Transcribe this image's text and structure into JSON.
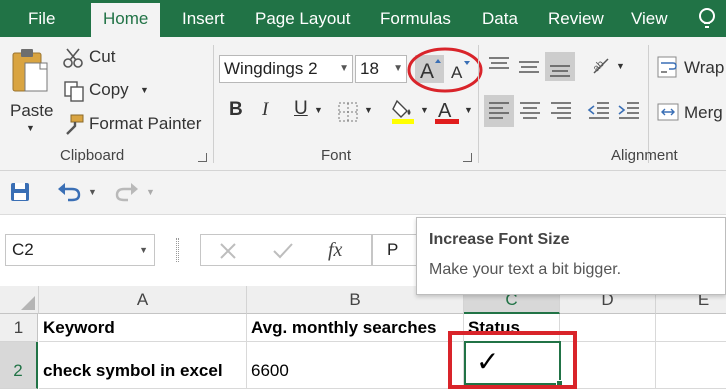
{
  "tabs": [
    {
      "id": "file",
      "label": "File"
    },
    {
      "id": "home",
      "label": "Home"
    },
    {
      "id": "insert",
      "label": "Insert"
    },
    {
      "id": "page-layout",
      "label": "Page Layout"
    },
    {
      "id": "formulas",
      "label": "Formulas"
    },
    {
      "id": "data",
      "label": "Data"
    },
    {
      "id": "review",
      "label": "Review"
    },
    {
      "id": "view",
      "label": "View"
    }
  ],
  "active_tab": "Home",
  "clipboard": {
    "paste_label": "Paste",
    "cut_label": "Cut",
    "copy_label": "Copy",
    "format_painter_label": "Format Painter",
    "group_label": "Clipboard"
  },
  "font": {
    "font_name": "Wingdings 2",
    "font_size": "18",
    "group_label": "Font"
  },
  "alignment": {
    "wrap_label": "Wrap",
    "merge_label": "Merg",
    "group_label": "Alignment"
  },
  "formula_bar": {
    "name_box": "C2",
    "content": "P"
  },
  "tooltip": {
    "title": "Increase Font Size",
    "body": "Make your text a bit bigger."
  },
  "sheet": {
    "columns": [
      "A",
      "B",
      "C",
      "D",
      "E"
    ],
    "rows": [
      {
        "num": "1",
        "cells": [
          "Keyword",
          "Avg. monthly searches",
          "Status",
          "",
          ""
        ]
      },
      {
        "num": "2",
        "cells": [
          "check symbol in excel",
          "6600",
          "✓",
          "",
          ""
        ]
      }
    ],
    "selected_cell": "C2"
  },
  "colors": {
    "ribbon_green": "#217346",
    "highlight_red": "#d9242a",
    "font_color_red": "#e01c1c",
    "highlight_yellow": "#ffff00"
  }
}
